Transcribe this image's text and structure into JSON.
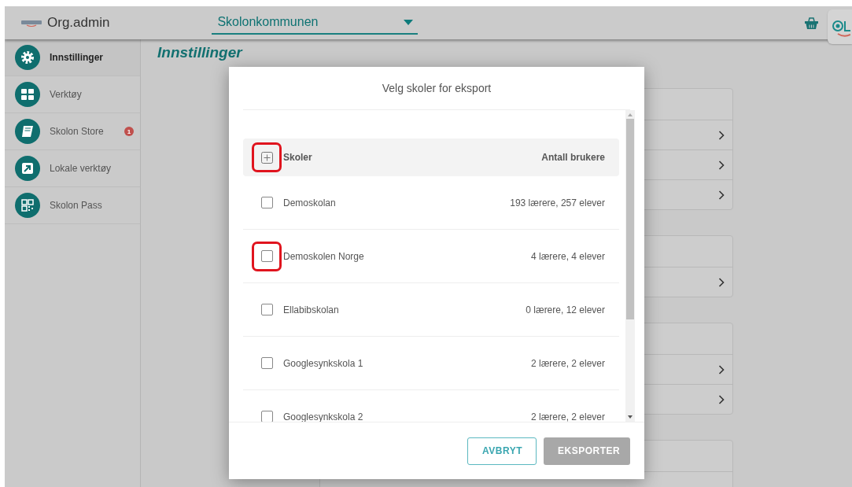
{
  "header": {
    "app_title": "Org.admin",
    "organization_select": {
      "value": "Skolonkommunen"
    }
  },
  "sidebar": {
    "items": [
      {
        "label": "Innstillinger",
        "selected": true
      },
      {
        "label": "Verktøy",
        "selected": false
      },
      {
        "label": "Skolon Store",
        "selected": false,
        "badge": "1"
      },
      {
        "label": "Lokale verktøy",
        "selected": false
      },
      {
        "label": "Skolon Pass",
        "selected": false
      }
    ]
  },
  "page_title": "Innstillinger",
  "background_cards": [
    {
      "rows": [
        {
          "chevron": false
        },
        {
          "chevron": true
        },
        {
          "chevron": true
        },
        {
          "chevron": true
        }
      ]
    },
    {
      "rows": [
        {
          "chevron": false
        },
        {
          "chevron": true
        }
      ]
    },
    {
      "rows": [
        {
          "chevron": false
        },
        {
          "chevron": true
        },
        {
          "chevron": true
        }
      ]
    },
    {
      "rows": [
        {
          "chevron": false
        },
        {
          "chevron": false
        }
      ]
    }
  ],
  "dialog": {
    "title": "Velg skoler for eksport",
    "table": {
      "columns": [
        "Skoler",
        "Antall brukere"
      ],
      "expand_highlighted": true,
      "rows": [
        {
          "school": "Demoskolan",
          "users": "193 lærere, 257 elever",
          "checked": false,
          "highlighted": false
        },
        {
          "school": "Demoskolen Norge",
          "users": "4 lærere, 4 elever",
          "checked": false,
          "highlighted": true
        },
        {
          "school": "Ellabibskolan",
          "users": "0 lærere, 12 elever",
          "checked": false,
          "highlighted": false
        },
        {
          "school": "Googlesynkskola 1",
          "users": "2 lærere, 2 elever",
          "checked": false,
          "highlighted": false
        },
        {
          "school": "Googlesynkskola 2",
          "users": "2 lærere, 2 elever",
          "checked": false,
          "highlighted": false
        }
      ]
    },
    "buttons": [
      {
        "label": "AVBRYT",
        "kind": "outlined",
        "disabled": false
      },
      {
        "label": "EKSPORTER",
        "kind": "filled",
        "disabled": true
      }
    ]
  }
}
